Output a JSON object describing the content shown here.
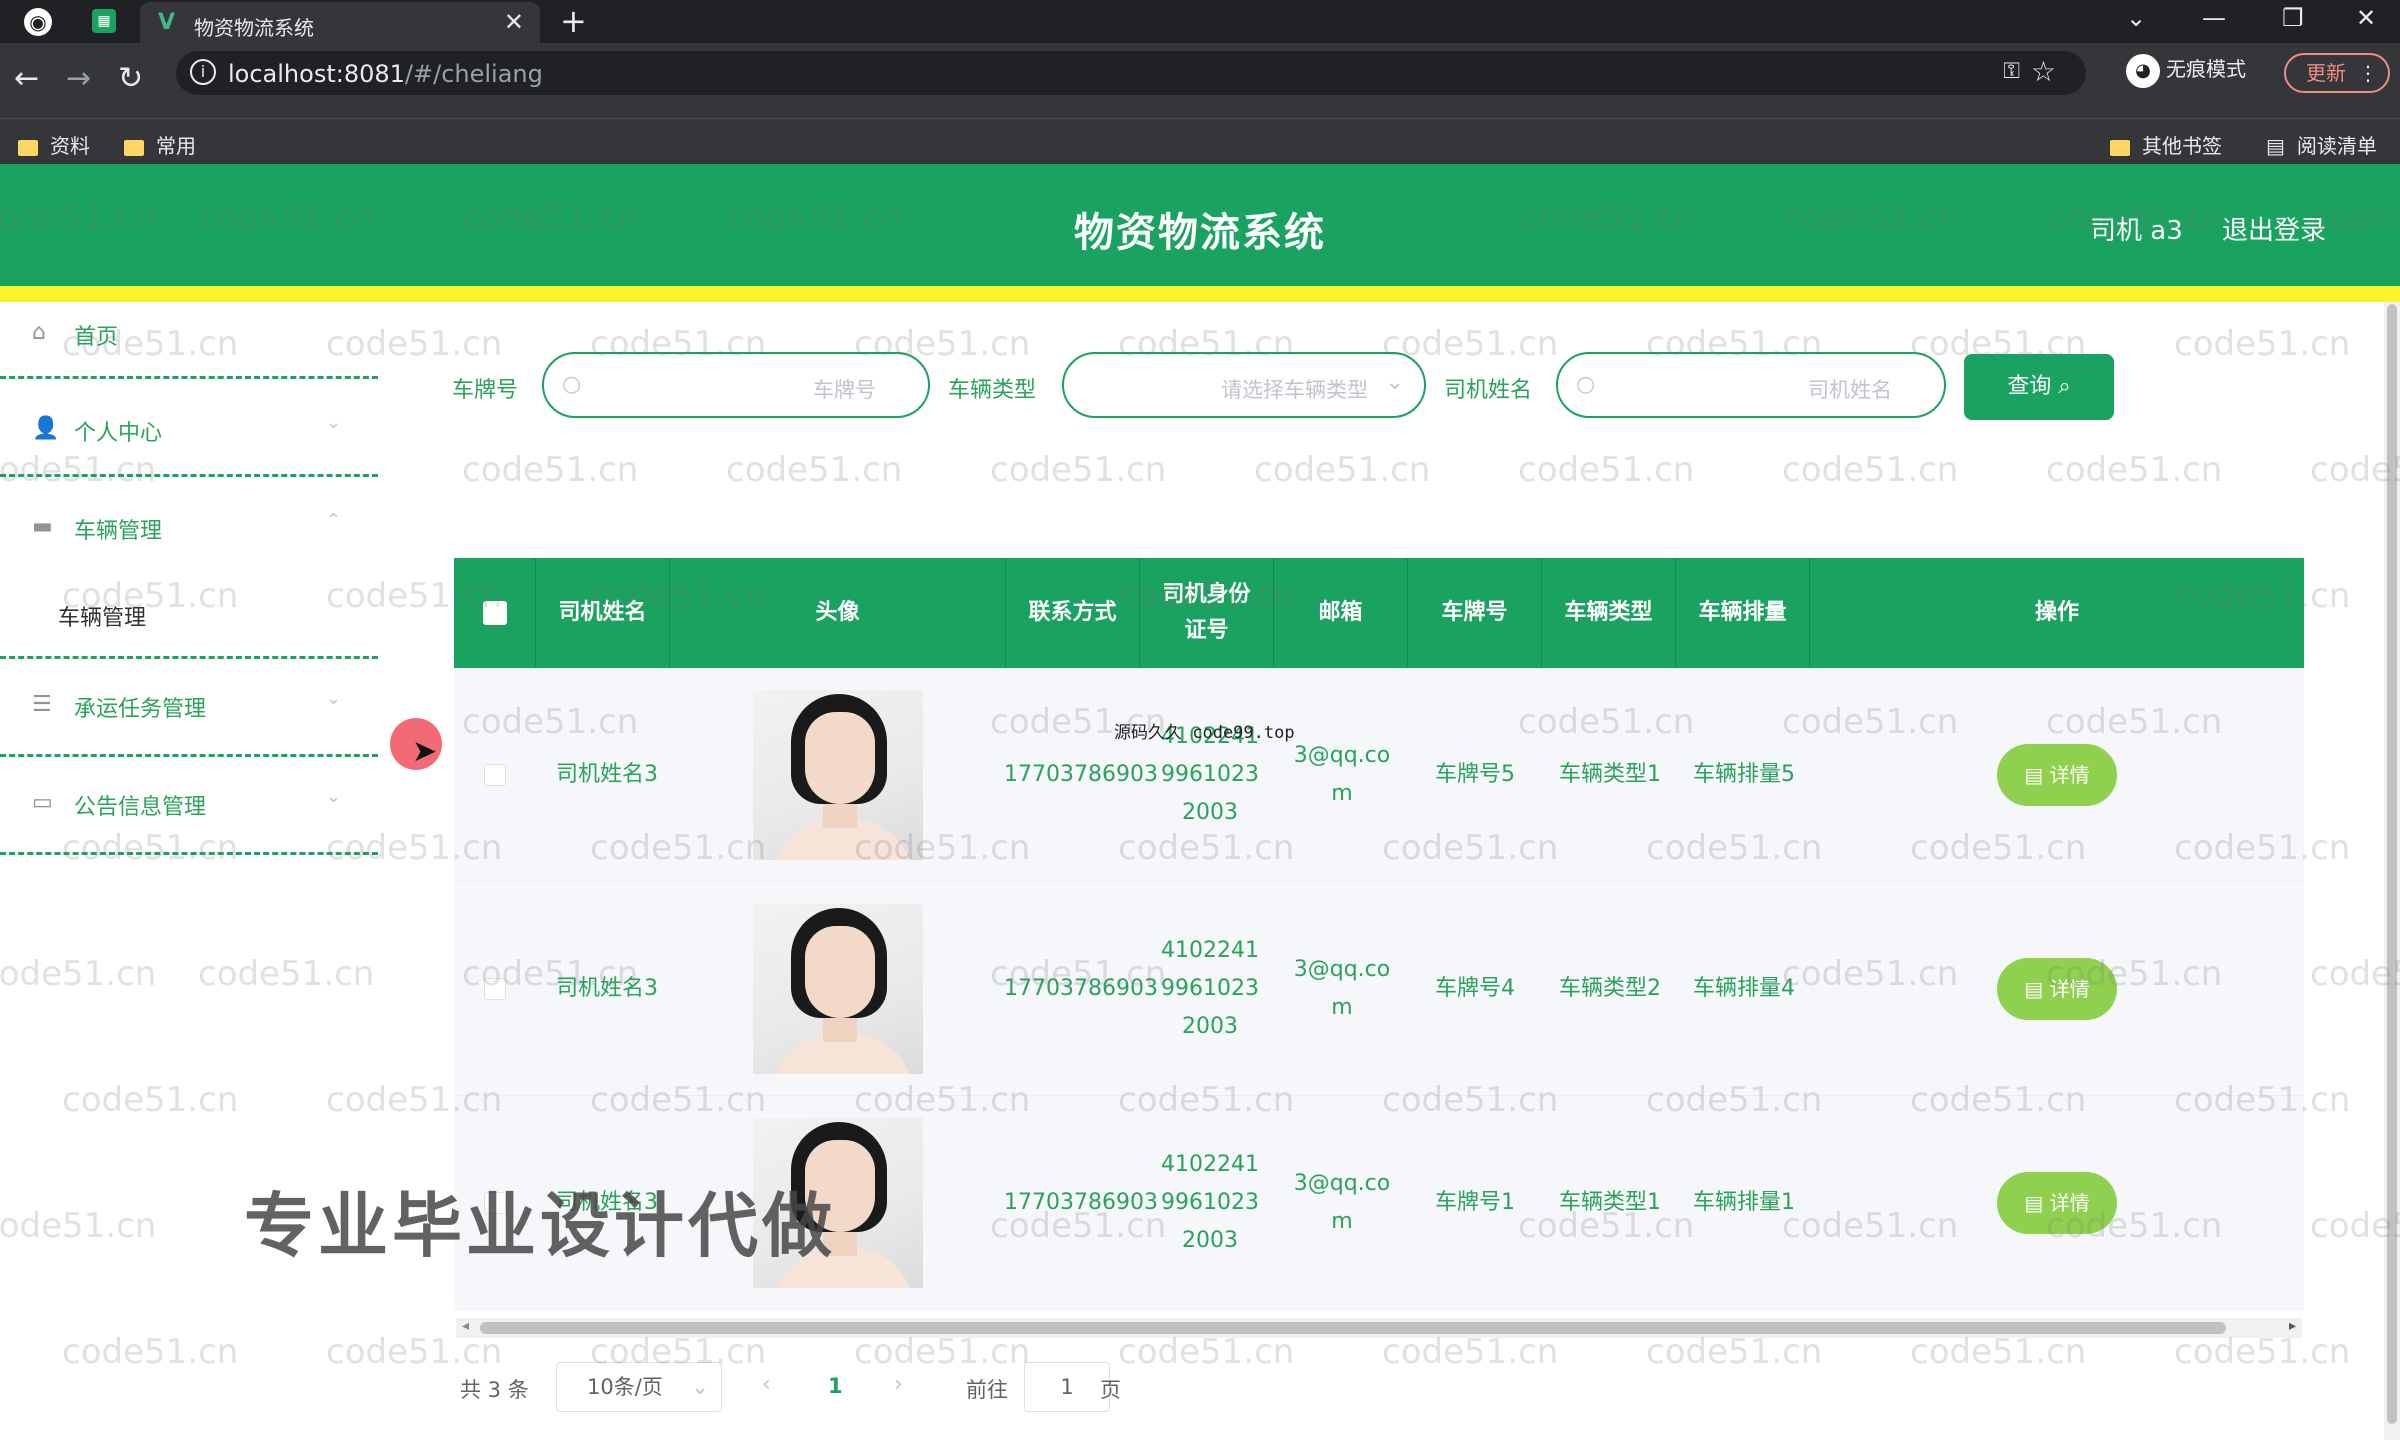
{
  "browser": {
    "tab_title": "物资物流系统",
    "url_host": "localhost:8081",
    "url_path": "/#/cheliang",
    "incognito_label": "无痕模式",
    "update_label": "更新",
    "bookmarks": [
      "资料",
      "常用"
    ],
    "bookmarks_right": [
      "其他书签",
      "阅读清单"
    ]
  },
  "header": {
    "title": "物资物流系统",
    "user": "司机 a3",
    "logout": "退出登录",
    "accent_color": "#1aa260",
    "stripe_color": "#f8f32b"
  },
  "sidebar": {
    "items": [
      {
        "label": "首页",
        "icon": "home-icon"
      },
      {
        "label": "个人中心",
        "icon": "user-icon"
      },
      {
        "label": "车辆管理",
        "icon": "monitor-icon"
      },
      {
        "label": "承运任务管理",
        "icon": "list-icon"
      },
      {
        "label": "公告信息管理",
        "icon": "chat-icon"
      }
    ],
    "submenu": {
      "label": "车辆管理"
    }
  },
  "search": {
    "plate_label": "车牌号",
    "plate_placeholder": "车牌号",
    "type_label": "车辆类型",
    "type_placeholder": "请选择车辆类型",
    "driver_label": "司机姓名",
    "driver_placeholder": "司机姓名",
    "query_button": "查询"
  },
  "table": {
    "headers": [
      "司机姓名",
      "头像",
      "联系方式",
      "司机身份证号",
      "邮箱",
      "车牌号",
      "车辆类型",
      "车辆排量",
      "操作"
    ],
    "rows": [
      {
        "driver": "司机姓名3",
        "phone": "17703786903",
        "idcard": "410224199610232003",
        "email": "3@qq.com",
        "plate": "车牌号5",
        "type": "车辆类型1",
        "displacement": "车辆排量5",
        "action": "详情"
      },
      {
        "driver": "司机姓名3",
        "phone": "17703786903",
        "idcard": "410224199610232003",
        "email": "3@qq.com",
        "plate": "车牌号4",
        "type": "车辆类型2",
        "displacement": "车辆排量4",
        "action": "详情"
      },
      {
        "driver": "司机姓名3",
        "phone": "17703786903",
        "idcard": "410224199610232003",
        "email": "3@qq.com",
        "plate": "车牌号1",
        "type": "车辆类型1",
        "displacement": "车辆排量1",
        "action": "详情"
      }
    ]
  },
  "pagination": {
    "total": "共 3 条",
    "page_size": "10条/页",
    "current_page": "1",
    "goto_label": "前往",
    "goto_value": "1",
    "page_suffix": "页"
  },
  "overlays": {
    "watermark": "code51.cn",
    "note": "源码久久 code99.top",
    "promo": "专业毕业设计代做"
  }
}
